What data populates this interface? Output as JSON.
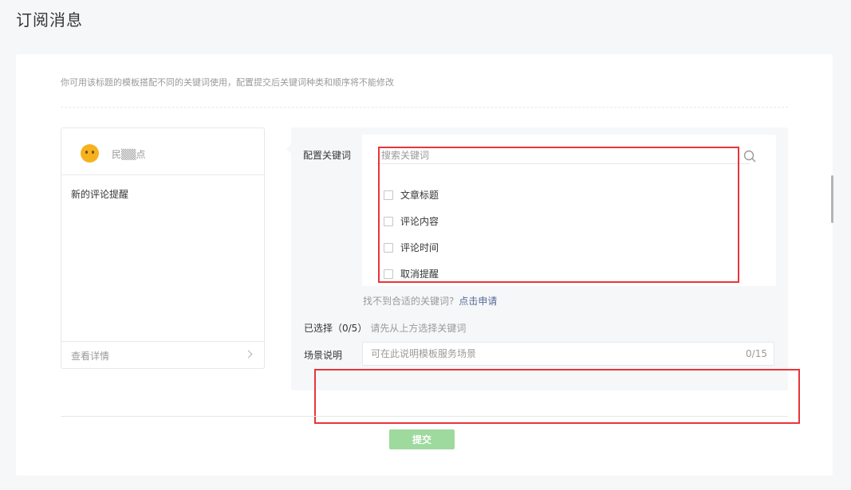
{
  "page": {
    "title": "订阅消息"
  },
  "tip": "你可用该标题的模板搭配不同的关键词使用，配置提交后关键词种类和顺序将不能修改",
  "preview": {
    "account_name": "民▒▒点",
    "message_title": "新的评论提醒",
    "view_detail": "查看详情"
  },
  "config": {
    "keywords_label": "配置关键词",
    "search_placeholder": "搜索关键词",
    "keywords": [
      {
        "label": "文章标题",
        "checked": false
      },
      {
        "label": "评论内容",
        "checked": false
      },
      {
        "label": "评论时间",
        "checked": false
      },
      {
        "label": "取消提醒",
        "checked": false
      }
    ],
    "not_found_text": "找不到合适的关键词?",
    "apply_link": "点击申请",
    "selected_count": "已选择（0/5）",
    "selected_hint": "请先从上方选择关键词",
    "scene_label": "场景说明",
    "scene_placeholder": "可在此说明模板服务场景",
    "scene_counter": "0/15"
  },
  "submit_label": "提交",
  "colors": {
    "highlight": "#e8353a",
    "submit_disabled": "#9ed99d",
    "link": "#576b95"
  }
}
